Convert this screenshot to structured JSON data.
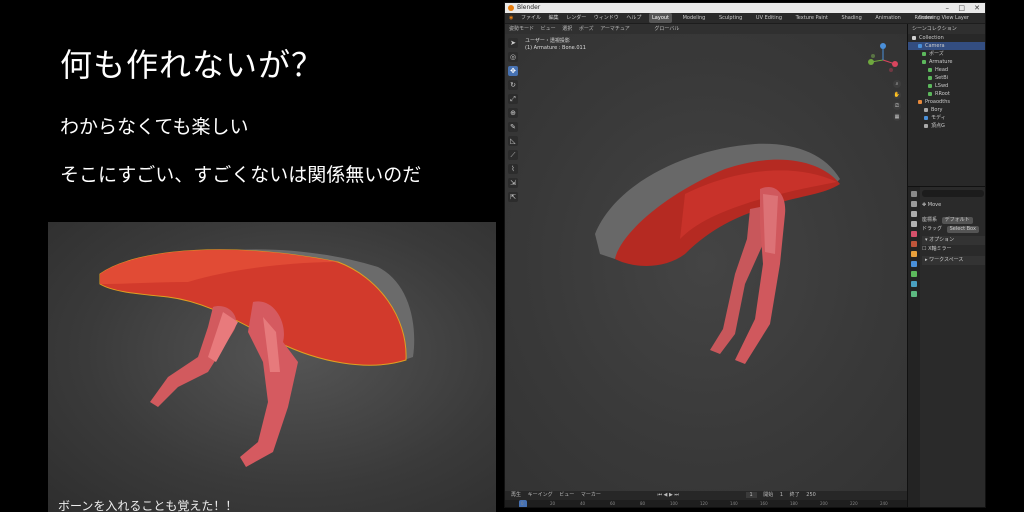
{
  "slide": {
    "title": "何も作れないが？",
    "line1": "わからなくても楽しい",
    "line2": "そこにすごい、すごくないは関係無いのだ",
    "caption": "ボーンを入れることも覚えた！！"
  },
  "blender": {
    "window_title": "Blender",
    "menu": [
      "ファイル",
      "編集",
      "レンダー",
      "ウィンドウ",
      "ヘルプ"
    ],
    "workspaces": [
      "Layout",
      "Modeling",
      "Sculpting",
      "UV Editing",
      "Texture Paint",
      "Shading",
      "Animation",
      "Rendering"
    ],
    "active_workspace": "Layout",
    "scene_name": "Scene",
    "view_layer": "View Layer",
    "viewport_header": [
      "姿勢モード",
      "ビュー",
      "選択",
      "ポーズ",
      "アーマチュア"
    ],
    "transform_orientation": "グローバル",
    "viewport_info": {
      "view": "ユーザー・透視投影",
      "object": "(1) Armature : Bone.011"
    },
    "timeline": {
      "menus": [
        "再生",
        "キーイング",
        "ビュー",
        "マーカー"
      ],
      "current_frame": "1",
      "start_label": "開始",
      "start": "1",
      "end_label": "終了",
      "end": "250",
      "ticks": [
        "0",
        "20",
        "40",
        "60",
        "80",
        "100",
        "120",
        "140",
        "160",
        "180",
        "200",
        "220",
        "240"
      ]
    },
    "outliner": {
      "header": "シーンコレクション",
      "rows": [
        {
          "label": "Collection",
          "color": "#d0d0d0",
          "selected": false
        },
        {
          "label": "Camera",
          "color": "#4a90d9",
          "selected": true
        },
        {
          "label": "ポーズ",
          "color": "#5cb85c",
          "selected": false
        },
        {
          "label": "Armature",
          "color": "#5cb85c",
          "selected": false
        },
        {
          "label": "Head",
          "color": "#5cb85c",
          "selected": false
        },
        {
          "label": "SetBi",
          "color": "#5cb85c",
          "selected": false
        },
        {
          "label": "LSwd",
          "color": "#5cb85c",
          "selected": false
        },
        {
          "label": "RRoot",
          "color": "#5cb85c",
          "selected": false
        },
        {
          "label": "Proaodths",
          "color": "#e88a3c",
          "selected": false
        },
        {
          "label": "Bory",
          "color": "#aaaaaa",
          "selected": false
        },
        {
          "label": "モディ",
          "color": "#4a90d9",
          "selected": false
        },
        {
          "label": "頂点G",
          "color": "#aaaaaa",
          "selected": false
        }
      ]
    },
    "properties": {
      "tool_name": "Move",
      "orientation_label": "座標系",
      "orientation_value": "デフォルト",
      "drag_label": "ドラッグ",
      "drag_value": "Select Box",
      "panel_options": "オプション",
      "mirror_label": "X軸ミラー",
      "workspace_panel": "ワークスペース"
    }
  }
}
